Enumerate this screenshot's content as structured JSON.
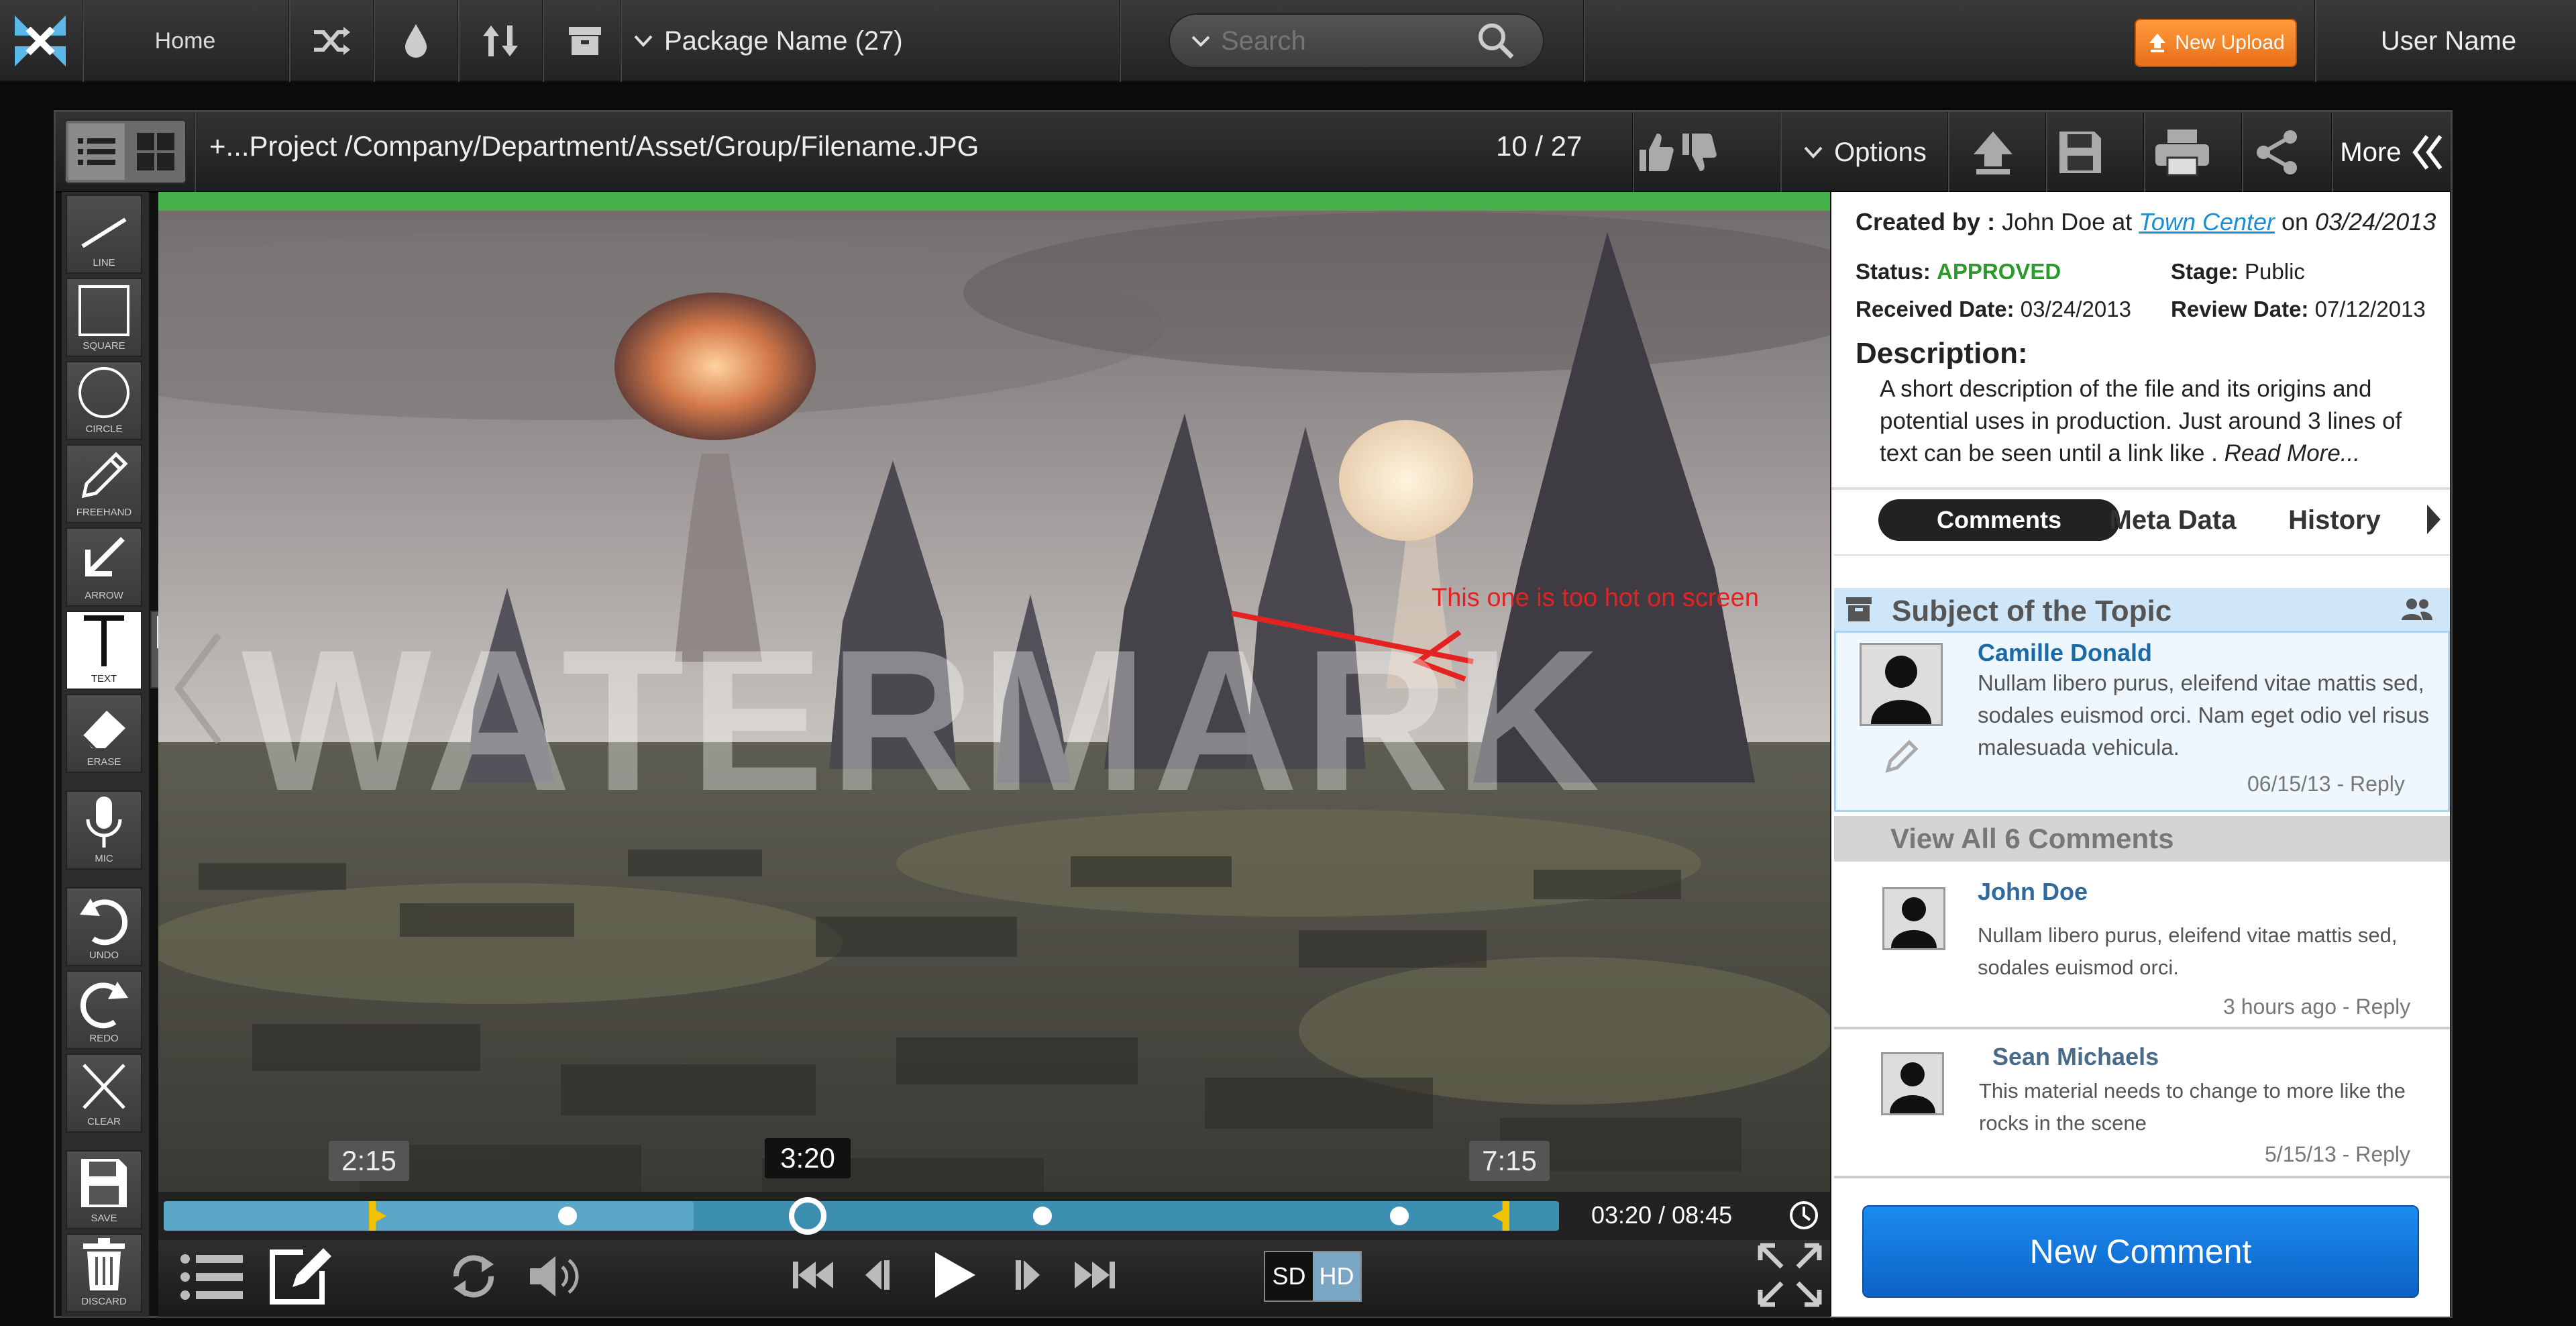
{
  "topbar": {
    "home": "Home",
    "package": "Package Name (27)",
    "search_placeholder": "Search",
    "new_upload": "New Upload",
    "user": "User Name"
  },
  "viewer": {
    "breadcrumb": "+...Project /Company/Department/Asset/Group/Filename.JPG",
    "counter": "10 / 27",
    "options": "Options",
    "more": "More"
  },
  "tools": [
    {
      "label": "LINE",
      "icon": "line-icon"
    },
    {
      "label": "SQUARE",
      "icon": "square-icon"
    },
    {
      "label": "CIRCLE",
      "icon": "circle-icon"
    },
    {
      "label": "FREEHAND",
      "icon": "pencil-icon"
    },
    {
      "label": "ARROW",
      "icon": "arrow-icon"
    },
    {
      "label": "TEXT",
      "icon": "text-icon"
    },
    {
      "label": "ERASE",
      "icon": "eraser-icon"
    },
    {
      "label": "MIC",
      "icon": "mic-icon"
    },
    {
      "label": "UNDO",
      "icon": "undo-icon"
    },
    {
      "label": "REDO",
      "icon": "redo-icon"
    },
    {
      "label": "CLEAR",
      "icon": "clear-icon"
    },
    {
      "label": "SAVE",
      "icon": "save-icon"
    },
    {
      "label": "DISCARD",
      "icon": "trash-icon"
    }
  ],
  "text_tool": {
    "font_size": "12",
    "color": "#b01010"
  },
  "image": {
    "watermark": "WATERMARK",
    "annotation": "This one is too hot on screen"
  },
  "timeline": {
    "marker_in": "2:15",
    "marker_current": "3:20",
    "marker_out": "7:15",
    "time": "03:20 / 08:45",
    "progress": 0.38
  },
  "quality": {
    "sd": "SD",
    "hd": "HD"
  },
  "info": {
    "created_by_label": "Created by :",
    "created_by": "John Doe at",
    "location": "Town Center",
    "on": "on",
    "created_date": "03/24/2013",
    "status_label": "Status:",
    "status": "APPROVED",
    "stage_label": "Stage:",
    "stage": "Public",
    "received_label": "Received Date:",
    "received": "03/24/2013",
    "review_label": "Review Date:",
    "review": "07/12/2013",
    "description_title": "Description:",
    "description": "A short description of the file and its origins and potential uses in production. Just around 3 lines of text can be seen until a link like .",
    "read_more": "Read More..."
  },
  "tabs": [
    "Comments",
    "Meta Data",
    "History"
  ],
  "topic": {
    "title": "Subject of the Topic"
  },
  "comments": [
    {
      "name": "Camille Donald",
      "body": "Nullam libero purus, eleifend vitae mattis sed, sodales euismod orci. Nam eget odio vel risus malesuada vehicula.",
      "meta": "06/15/13 - Reply"
    },
    {
      "name": "John Doe",
      "body": "Nullam libero purus, eleifend vitae mattis sed, sodales euismod orci.",
      "meta": "3 hours ago - Reply"
    },
    {
      "name": "Sean Michaels",
      "body": "This material needs to change to more like the rocks in the scene",
      "meta": "5/15/13 - Reply"
    }
  ],
  "view_all": "View All 6 Comments",
  "new_comment": "New Comment",
  "colors": {
    "accent": "#1b8cf0",
    "upload": "#f0852a",
    "approved": "#2a9a2a",
    "timeline": "#3d8fb2"
  }
}
